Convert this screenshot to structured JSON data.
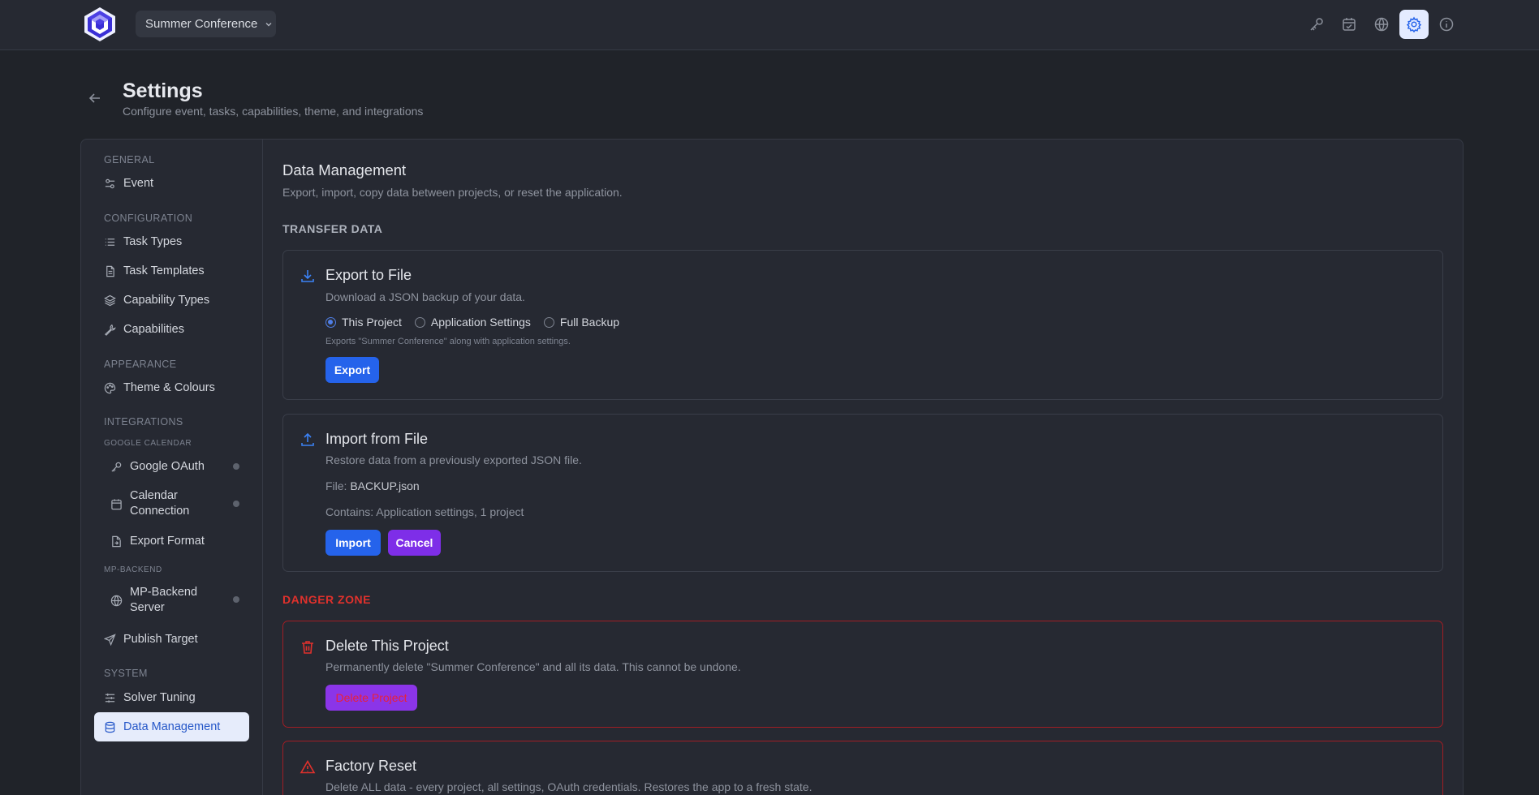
{
  "header": {
    "project_name": "Summer Conference",
    "icons": [
      "key-icon",
      "calendar-check-icon",
      "globe-icon",
      "gear-icon",
      "info-icon"
    ],
    "active_icon": "gear-icon"
  },
  "page": {
    "title": "Settings",
    "subtitle": "Configure event, tasks, capabilities, theme, and integrations"
  },
  "sidebar": {
    "general": "GENERAL",
    "event": "Event",
    "configuration": "CONFIGURATION",
    "task_types": "Task Types",
    "task_templates": "Task Templates",
    "capability_types": "Capability Types",
    "capabilities": "Capabilities",
    "appearance": "APPEARANCE",
    "theme": "Theme & Colours",
    "integrations": "INTEGRATIONS",
    "google_calendar": "GOOGLE CALENDAR",
    "google_oauth": "Google OAuth",
    "calendar_connection_1": "Calendar",
    "calendar_connection_2": "Connection",
    "export_format": "Export Format",
    "mp_backend": "MP-BACKEND",
    "mp_backend_server_1": "MP-Backend",
    "mp_backend_server_2": "Server",
    "publish_target": "Publish Target",
    "system": "SYSTEM",
    "solver_tuning": "Solver Tuning",
    "data_management": "Data Management",
    "active_item": "Data Management"
  },
  "content": {
    "title": "Data Management",
    "subtitle": "Export, import, copy data between projects, or reset the application.",
    "transfer_label": "TRANSFER DATA",
    "export": {
      "title": "Export to File",
      "desc": "Download a JSON backup of your data.",
      "options": [
        "This Project",
        "Application Settings",
        "Full Backup"
      ],
      "selected": "This Project",
      "note": "Exports \"Summer Conference\" along with application settings.",
      "button": "Export"
    },
    "import": {
      "title": "Import from File",
      "desc": "Restore data from a previously exported JSON file.",
      "file_label": "File:",
      "file_name": "BACKUP.json",
      "contains": "Contains: Application settings, 1 project",
      "import_button": "Import",
      "cancel_button": "Cancel"
    },
    "danger_label": "DANGER ZONE",
    "delete": {
      "title": "Delete This Project",
      "desc": "Permanently delete \"Summer Conference\" and all its data. This cannot be undone.",
      "button": "Delete Project"
    },
    "reset": {
      "title": "Factory Reset",
      "desc": "Delete ALL data - every project, all settings, OAuth credentials. Restores the app to a fresh state."
    }
  },
  "colors": {
    "accent": "#2563eb",
    "danger": "#e0312c",
    "purple": "#7e2ee8",
    "background": "#202329"
  }
}
